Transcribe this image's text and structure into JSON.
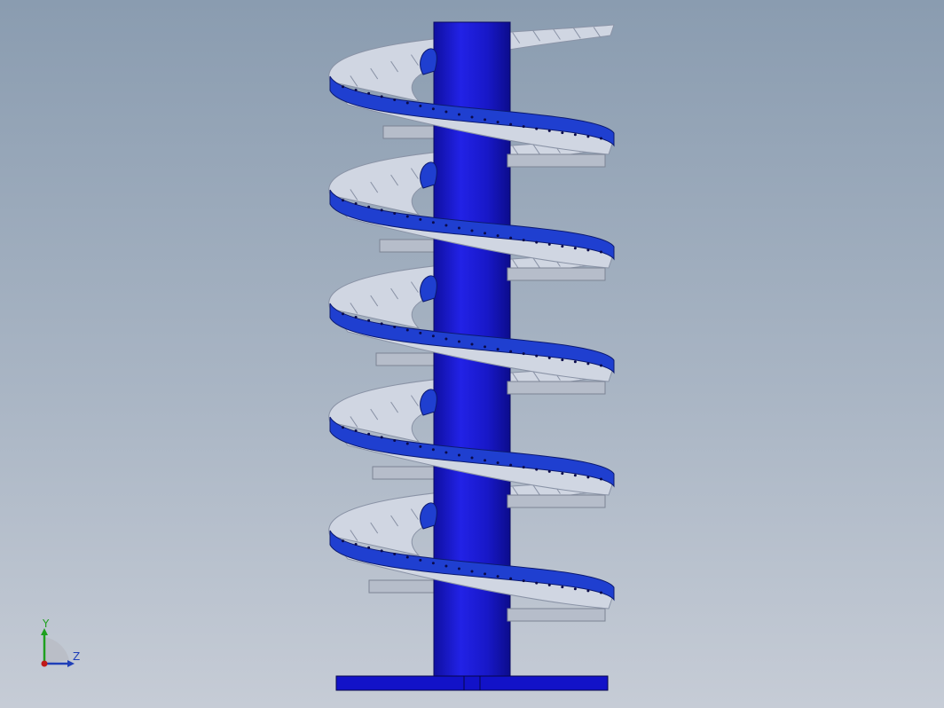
{
  "viewport": {
    "name": "graphics-area"
  },
  "model": {
    "name": "spiral-conveyor",
    "turns": 5,
    "colors": {
      "column": "#1a1ad2",
      "column_shade": "#0d0d8a",
      "guide_rail": "#1f3fd0",
      "rail_holes": "#0a0a4a",
      "rollers": "#d0d6e2",
      "roller_edge": "#8a93a6",
      "supports": "#b6bdca",
      "base_plate": "#1212c8"
    }
  },
  "triad": {
    "y_label": "Y",
    "z_label": "Z",
    "colors": {
      "y": "#1ea01e",
      "z": "#1f3fb8",
      "x": "#c01818"
    }
  }
}
